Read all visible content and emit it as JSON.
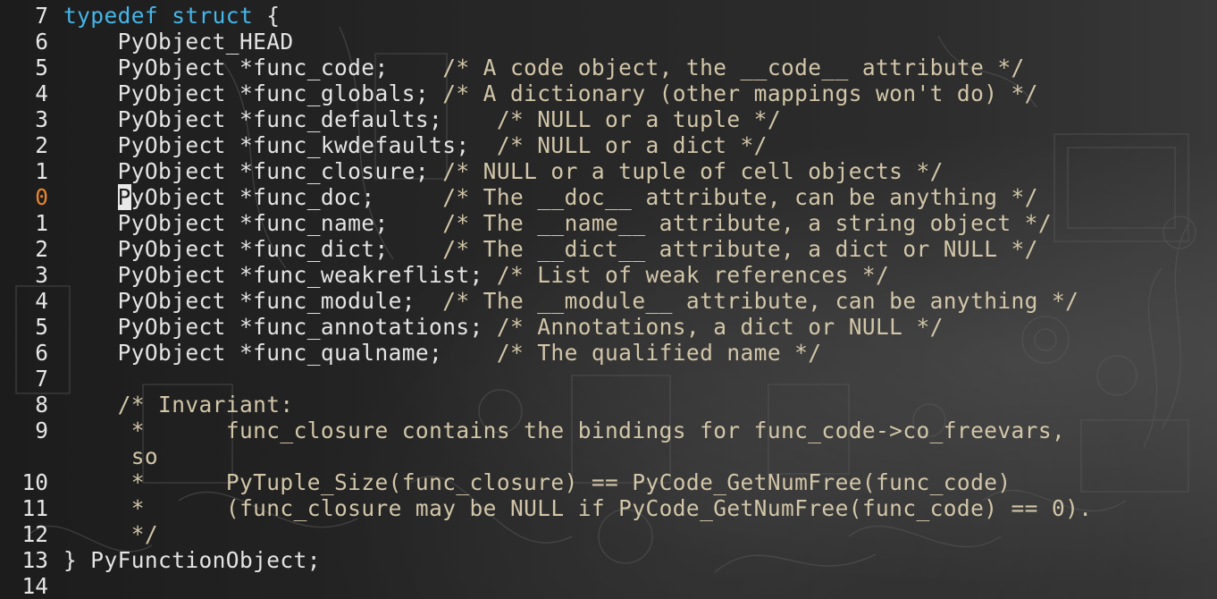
{
  "editor": {
    "current_line_number": "0",
    "lines": [
      {
        "num": "7",
        "kw": "typedef struct",
        "code": " {",
        "comment": ""
      },
      {
        "num": "6",
        "kw": "",
        "code": "    PyObject_HEAD",
        "comment": ""
      },
      {
        "num": "5",
        "kw": "",
        "code": "    PyObject *func_code;    ",
        "comment": "/* A code object, the __code__ attribute */"
      },
      {
        "num": "4",
        "kw": "",
        "code": "    PyObject *func_globals; ",
        "comment": "/* A dictionary (other mappings won't do) */"
      },
      {
        "num": "3",
        "kw": "",
        "code": "    PyObject *func_defaults;    ",
        "comment": "/* NULL or a tuple */"
      },
      {
        "num": "2",
        "kw": "",
        "code": "    PyObject *func_kwdefaults;  ",
        "comment": "/* NULL or a dict */"
      },
      {
        "num": "1",
        "kw": "",
        "code": "    PyObject *func_closure; ",
        "comment": "/* NULL or a tuple of cell objects */"
      },
      {
        "num": "0",
        "kw": "",
        "cursor_char": "P",
        "code": "yObject *func_doc;     ",
        "comment": "/* The __doc__ attribute, can be anything */"
      },
      {
        "num": "1",
        "kw": "",
        "code": "    PyObject *func_name;    ",
        "comment": "/* The __name__ attribute, a string object */"
      },
      {
        "num": "2",
        "kw": "",
        "code": "    PyObject *func_dict;    ",
        "comment": "/* The __dict__ attribute, a dict or NULL */"
      },
      {
        "num": "3",
        "kw": "",
        "code": "    PyObject *func_weakreflist; ",
        "comment": "/* List of weak references */"
      },
      {
        "num": "4",
        "kw": "",
        "code": "    PyObject *func_module;  ",
        "comment": "/* The __module__ attribute, can be anything */"
      },
      {
        "num": "5",
        "kw": "",
        "code": "    PyObject *func_annotations; ",
        "comment": "/* Annotations, a dict or NULL */"
      },
      {
        "num": "6",
        "kw": "",
        "code": "    PyObject *func_qualname;    ",
        "comment": "/* The qualified name */"
      },
      {
        "num": "7",
        "kw": "",
        "code": "",
        "comment": ""
      },
      {
        "num": "8",
        "kw": "",
        "code": "    ",
        "comment": "/* Invariant:"
      },
      {
        "num": "9",
        "kw": "",
        "code": "     ",
        "comment": "*      func_closure contains the bindings for func_code->co_freevars,"
      },
      {
        "num": "",
        "kw": "",
        "code": "     ",
        "comment": "so"
      },
      {
        "num": "10",
        "kw": "",
        "code": "     ",
        "comment": "*      PyTuple_Size(func_closure) == PyCode_GetNumFree(func_code)"
      },
      {
        "num": "11",
        "kw": "",
        "code": "     ",
        "comment": "*      (func_closure may be NULL if PyCode_GetNumFree(func_code) == 0)."
      },
      {
        "num": "12",
        "kw": "",
        "code": "     ",
        "comment": "*/"
      },
      {
        "num": "13",
        "kw": "",
        "code": "} PyFunctionObject;",
        "comment": ""
      },
      {
        "num": "14",
        "kw": "",
        "code": "",
        "comment": ""
      }
    ]
  },
  "colors": {
    "keyword": "#45b6e8",
    "comment": "#d2c6a8",
    "current_line_number": "#e8862a",
    "text": "#e4e4e4"
  }
}
